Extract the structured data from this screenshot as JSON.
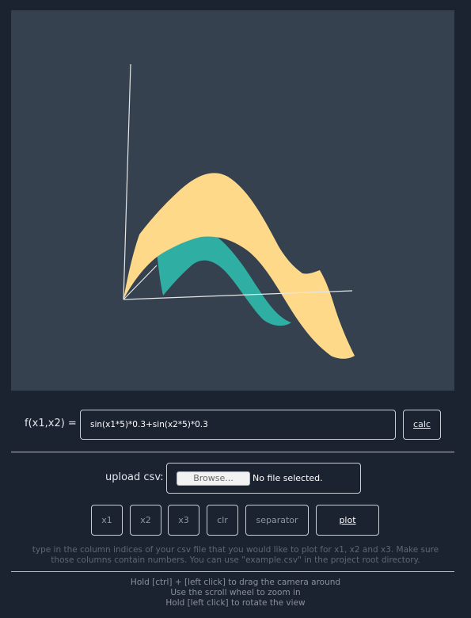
{
  "viewport": {
    "colors": {
      "background": "#35414e",
      "surface_front": "#ffd98a",
      "surface_back": "#2fafa3",
      "axes": "#e6e6e6"
    }
  },
  "formula": {
    "label": "f(x1,x2) =",
    "value": "sin(x1*5)*0.3+sin(x2*5)*0.3",
    "calc_label": "calc"
  },
  "upload": {
    "label": "upload csv:",
    "browse_label": "Browse...",
    "file_status": "No file selected."
  },
  "columns": {
    "x1_label": "x1",
    "x2_label": "x2",
    "x3_label": "x3",
    "clr_label": "clr",
    "separator_label": "separator",
    "plot_label": "plot"
  },
  "help": {
    "line1": "type in the column indices of your csv file that you would like to plot for x1, x2 and x3. Make sure",
    "line2": "those columns contain numbers. You can use \"example.csv\" in the project root directory."
  },
  "hints": {
    "drag": "Hold [ctrl] + [left click] to drag the camera around",
    "zoom": "Use the scroll wheel to zoom in",
    "rotate": "Hold [left click] to rotate the view"
  }
}
